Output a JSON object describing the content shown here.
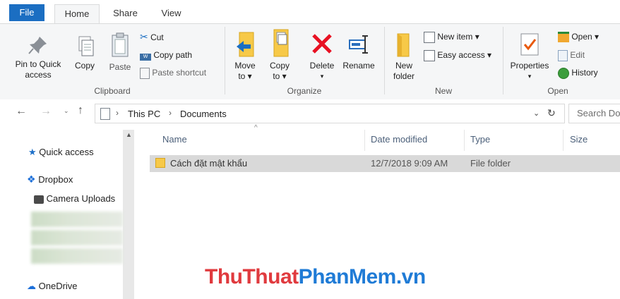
{
  "tabs": {
    "file": "File",
    "home": "Home",
    "share": "Share",
    "view": "View"
  },
  "ribbon": {
    "clipboard": {
      "pin_label_1": "Pin to Quick",
      "pin_label_2": "access",
      "copy": "Copy",
      "paste": "Paste",
      "cut": "Cut",
      "copy_path": "Copy path",
      "paste_shortcut": "Paste shortcut",
      "group": "Clipboard"
    },
    "organize": {
      "move_to_1": "Move",
      "move_to_2": "to ▾",
      "copy_to_1": "Copy",
      "copy_to_2": "to ▾",
      "delete": "Delete",
      "delete_arrow": "▾",
      "rename": "Rename",
      "group": "Organize"
    },
    "new": {
      "new_folder_1": "New",
      "new_folder_2": "folder",
      "new_item": "New item ▾",
      "easy_access": "Easy access ▾",
      "group": "New"
    },
    "open": {
      "properties": "Properties",
      "properties_arrow": "▾",
      "open": "Open ▾",
      "edit": "Edit",
      "history": "History",
      "group": "Open"
    }
  },
  "address": {
    "crumb1": "This PC",
    "crumb2": "Documents",
    "search_placeholder": "Search Do"
  },
  "nav": {
    "quick_access": "Quick access",
    "dropbox": "Dropbox",
    "camera_uploads": "Camera Uploads",
    "onedrive": "OneDrive"
  },
  "columns": {
    "name": "Name",
    "date": "Date modified",
    "type": "Type",
    "size": "Size"
  },
  "files": [
    {
      "name": "Cách đặt mật khẩu",
      "date": "12/7/2018 9:09 AM",
      "type": "File folder",
      "size": ""
    }
  ],
  "watermark": {
    "part1": "ThuThuat",
    "part2": "PhanMem",
    "part3": ".vn"
  },
  "colors": {
    "file_tab": "#1b6ec2",
    "selection": "#d9d9d9",
    "watermark_red": "#e03a3e",
    "watermark_blue": "#1f7bd6"
  }
}
